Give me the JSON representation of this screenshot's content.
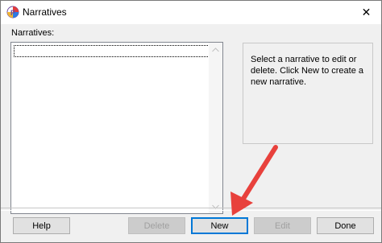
{
  "window": {
    "title": "Narratives",
    "close_glyph": "✕"
  },
  "list": {
    "label": "Narratives:",
    "items": []
  },
  "info": {
    "text": "Select a narrative to edit or delete.  Click New to create a new narrative."
  },
  "buttons": {
    "help": "Help",
    "delete": "Delete",
    "new": "New",
    "edit": "Edit",
    "done": "Done"
  },
  "colors": {
    "accent_focus": "#0078d7",
    "annotation_arrow": "#e8413c"
  },
  "icons": {
    "app": "narratives-app-icon",
    "close": "close-icon",
    "scroll_up": "chevron-up-icon",
    "scroll_down": "chevron-down-icon",
    "annotation": "red-arrow-annotation"
  }
}
